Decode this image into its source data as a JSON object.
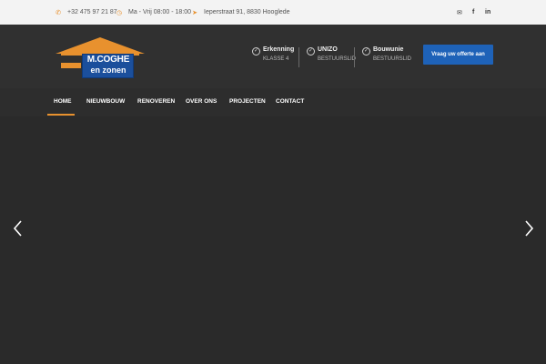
{
  "topbar": {
    "phone": "+32 475 97 21 87",
    "hours": "Ma - Vrij 08:00 - 18:00",
    "address": "Ieperstraat 91, 8830 Hooglede",
    "icons": {
      "phone": "phone-icon",
      "hours": "clock-icon",
      "address": "location-arrow-icon",
      "email": "envelope-icon",
      "facebook": "facebook-icon",
      "linkedin": "linkedin-icon"
    },
    "social": {
      "facebook": "f",
      "linkedin": "in"
    }
  },
  "logo": {
    "line1": "M.COGHE",
    "line2": "en zonen"
  },
  "certs": [
    {
      "name": "Erkenning",
      "sub": "KLASSE 4"
    },
    {
      "name": "UNIZO",
      "sub": "BESTUURSLID"
    },
    {
      "name": "Bouwunie",
      "sub": "BESTUURSLID"
    }
  ],
  "cta": {
    "label": "Vraag uw offerte aan"
  },
  "nav": [
    {
      "label": "HOME",
      "active": true
    },
    {
      "label": "NIEUWBOUW"
    },
    {
      "label": "RENOVEREN"
    },
    {
      "label": "OVER ONS"
    },
    {
      "label": "PROJECTEN"
    },
    {
      "label": "CONTACT"
    }
  ],
  "colors": {
    "accent": "#e8912e",
    "brand_blue": "#1e62b8",
    "header_bg": "#303030",
    "topbar_bg": "#f3f3f3"
  }
}
